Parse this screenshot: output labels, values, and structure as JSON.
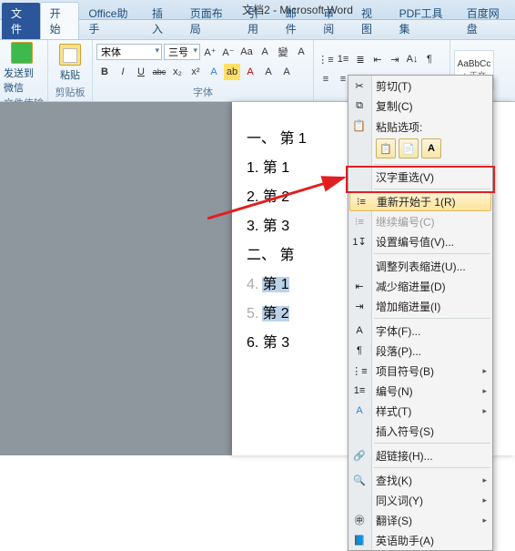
{
  "titlebar": {
    "title": "文档2 - Microsoft Word"
  },
  "tabs": {
    "file": "文件",
    "items": [
      "开始",
      "Office助手",
      "插入",
      "页面布局",
      "引用",
      "邮件",
      "审阅",
      "视图",
      "PDF工具集",
      "百度网盘"
    ],
    "active_index": 0
  },
  "ribbon": {
    "group_file": {
      "label": "文件传输",
      "btn": "发送到微信"
    },
    "group_clip": {
      "label": "剪贴板",
      "btn": "粘贴"
    },
    "group_font": {
      "label": "字体",
      "font_name": "宋体",
      "font_size": "三号",
      "btns_row1": [
        "A⁺",
        "A⁻",
        "Aa",
        "A",
        "變",
        "A"
      ],
      "btns_row2": [
        "B",
        "I",
        "U",
        "abc",
        "x₂",
        "x²",
        "A",
        "ab",
        "A",
        "A",
        "A"
      ]
    },
    "group_para": {
      "label": "",
      "row1": [
        "≡",
        "≡",
        "≡",
        "≡",
        "≡",
        "↕",
        "A↓",
        "¶"
      ],
      "row2": [
        "≡",
        "≡",
        "≡",
        "≡",
        "≡",
        "⋮",
        "田",
        "▭"
      ]
    },
    "group_style": {
      "name": "AaBbCc",
      "desc": "+ 正文"
    }
  },
  "doc": {
    "lines": [
      "一、 第 1",
      "1. 第 1",
      "2. 第 2",
      "3. 第 3",
      "二、 第",
      "第 1",
      "第 2",
      "6. 第 3"
    ],
    "list_prefix": [
      "4.",
      "5."
    ]
  },
  "ctx": {
    "cut": "剪切(T)",
    "copy": "复制(C)",
    "paste_label": "粘贴选项:",
    "hanzi": "汉字重选(V)",
    "restart": "重新开始于 1(R)",
    "continue": "继续编号(C)",
    "setval": "设置编号值(V)...",
    "adjust": "调整列表缩进(U)...",
    "dec": "减少缩进量(D)",
    "inc": "增加缩进量(I)",
    "font": "字体(F)...",
    "para": "段落(P)...",
    "bullets": "项目符号(B)",
    "numbering": "编号(N)",
    "styles": "样式(T)",
    "symbol": "插入符号(S)",
    "link": "超链接(H)...",
    "find": "查找(K)",
    "synonym": "同义词(Y)",
    "translate": "翻译(S)",
    "assistant": "英语助手(A)"
  }
}
